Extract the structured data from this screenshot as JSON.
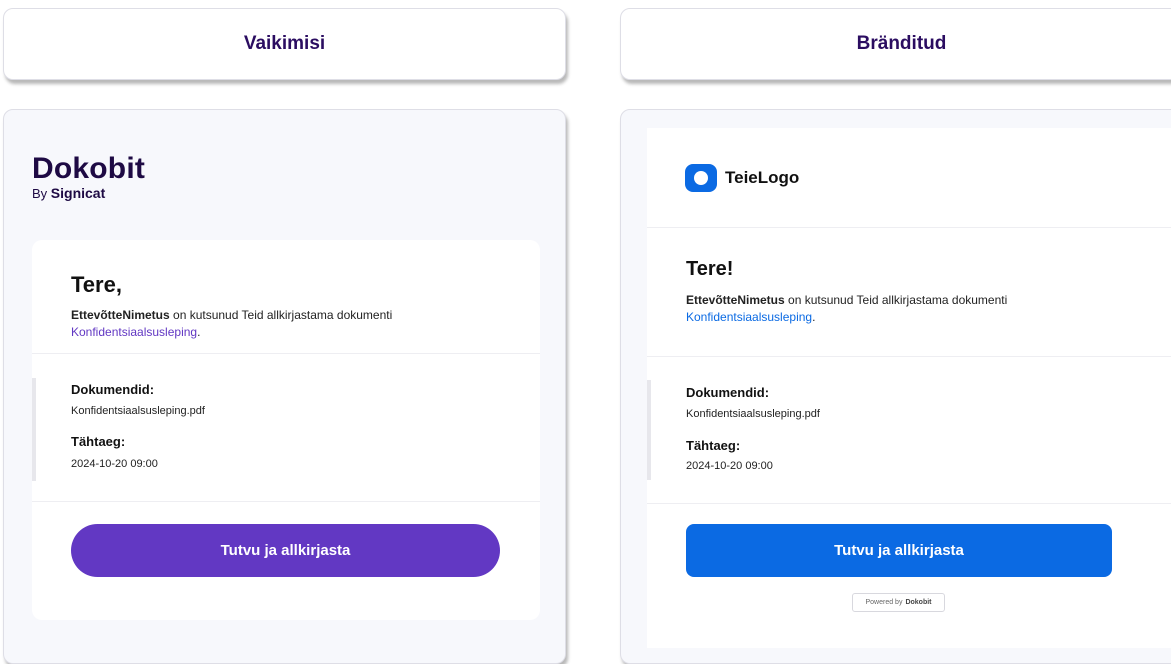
{
  "colors": {
    "default_accent": "#6238c3",
    "branded_accent": "#0b6ae3",
    "header_text": "#2b0d61"
  },
  "headers": {
    "default": "Vaikimisi",
    "branded": "Bränditud"
  },
  "default_email": {
    "logo": {
      "brand": "Dokobit",
      "by": "By",
      "parent": "Signicat"
    },
    "greeting": "Tere,",
    "company": "EttevõtteNimetus",
    "intro_text": " on kutsunud Teid allkirjastama dokumenti",
    "doc_link": "Konfidentsiaalsusleping",
    "link_period": ".",
    "documents_label": "Dokumendid:",
    "document_file": "Konfidentsiaalsusleping.pdf",
    "deadline_label": "Tähtaeg:",
    "deadline_value": "2024-10-20 09:00",
    "cta": "Tutvu ja allkirjasta"
  },
  "branded_email": {
    "logo": {
      "icon": "circle-logo-icon",
      "name": "TeieLogo"
    },
    "greeting": "Tere!",
    "company": "EttevõtteNimetus",
    "intro_text": " on kutsunud Teid allkirjastama dokumenti",
    "doc_link": "Konfidentsiaalsusleping",
    "link_period": ".",
    "documents_label": "Dokumendid:",
    "document_file": "Konfidentsiaalsusleping.pdf",
    "deadline_label": "Tähtaeg:",
    "deadline_value": "2024-10-20 09:00",
    "cta": "Tutvu ja allkirjasta",
    "powered_by": {
      "text": "Powered by",
      "brand": "Dokobit"
    }
  }
}
